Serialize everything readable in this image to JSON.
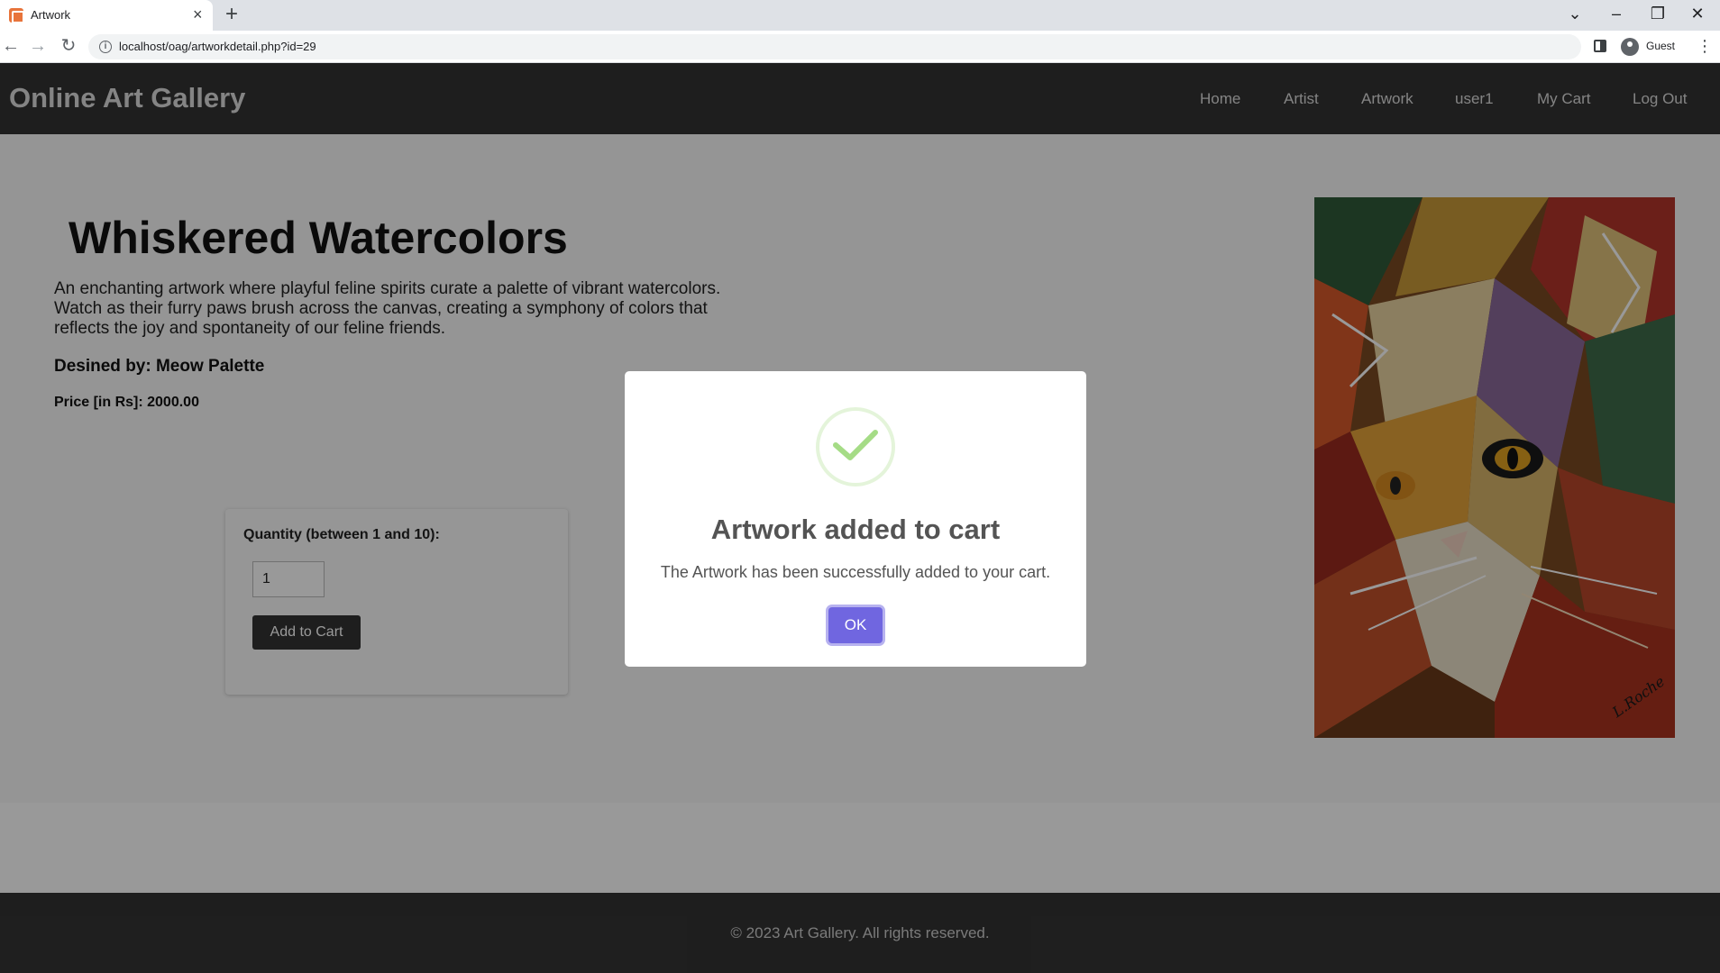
{
  "browser": {
    "tab_title": "Artwork",
    "url": "localhost/oag/artworkdetail.php?id=29",
    "profile_name": "Guest"
  },
  "site": {
    "title": "Online Art Gallery",
    "nav": [
      "Home",
      "Artist",
      "Artwork",
      "user1",
      "My Cart",
      "Log Out"
    ]
  },
  "artwork": {
    "title": "Whiskered Watercolors",
    "description": "An enchanting artwork where playful feline spirits curate a palette of vibrant watercolors. Watch as their furry paws brush across the canvas, creating a symphony of colors that reflects the joy and spontaneity of our feline friends.",
    "designer": "Desined by: Meow Palette",
    "price": "Price [in Rs]: 2000.00",
    "signature": "L.Roche"
  },
  "cart_form": {
    "quantity_label": "Quantity (between 1 and 10):",
    "quantity_value": "1",
    "add_button": "Add to Cart"
  },
  "footer": {
    "text": "© 2023 Art Gallery. All rights reserved."
  },
  "modal": {
    "title": "Artwork added to cart",
    "text": "The Artwork has been successfully added to your cart.",
    "ok_button": "OK"
  },
  "colors": {
    "header_bg": "#333333",
    "modal_button": "#7066e0",
    "success_check": "#a5dc86"
  }
}
